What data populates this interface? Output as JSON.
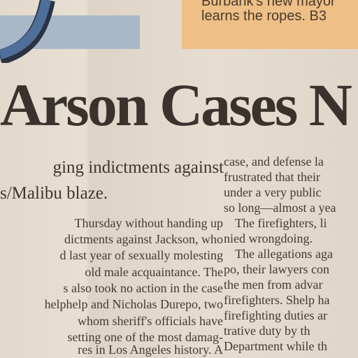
{
  "teaser": {
    "line1": "Burbank's new mayor",
    "line2": "learns the ropes. B3"
  },
  "headline": "Arson Cases N",
  "deck": [
    "ging indictments against",
    "s/Malibu blaze."
  ],
  "left_column": [
    "Thursday without handing up",
    "dictments against Jackson, who",
    "d last year of sexually molesting",
    "old male acquaintance. The",
    "s also took no action in the case",
    "helphelp and Nicholas Durepo, two",
    "whom sheriff's officials have",
    "setting one of the most damag-",
    "res in Los Angeles history. A"
  ],
  "right_column": [
    "case, and defense la",
    "frustrated that their",
    "under a very public",
    "so long—almost a yea",
    "  The firefighters, li",
    "nied wrongdoing.",
    "  The allegations aga",
    "po, their lawyers con",
    "the men from advar",
    "firefighters. Shelp ha",
    "firefighting duties ar",
    "trative duty by th",
    "Department while th"
  ],
  "colors": {
    "orange_box": "#eebf86",
    "blue_bar": "#a8b8c9",
    "logo_blue": "#4d6f9a"
  }
}
